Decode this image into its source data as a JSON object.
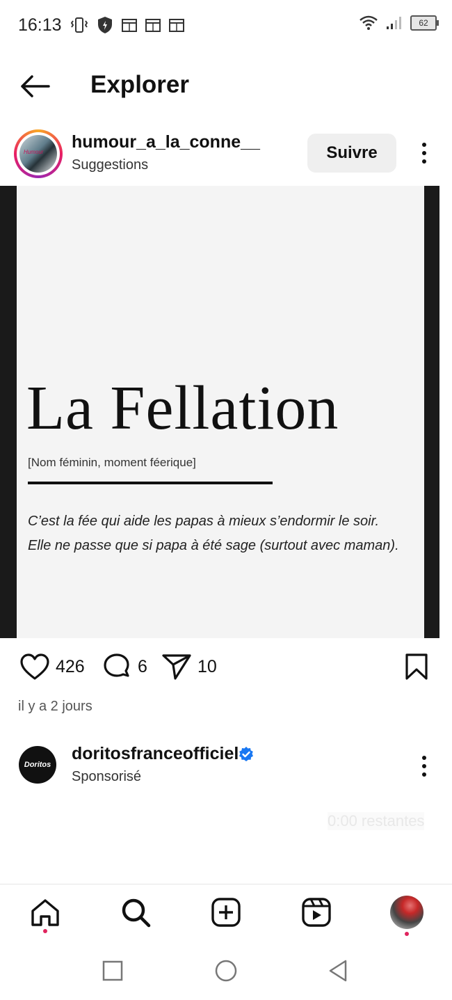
{
  "status_bar": {
    "time": "16:13",
    "battery": "62"
  },
  "header": {
    "title": "Explorer"
  },
  "post": {
    "username": "humour_a_la_conne__",
    "subtitle": "Suggestions",
    "follow_label": "Suivre",
    "image": {
      "word": "La Fellation",
      "grammar": "[Nom féminin, moment féerique]",
      "definition_line1": "C’est la fée qui aide les papas à mieux s’endormir le soir.",
      "definition_line2": "Elle ne passe que si papa à été sage (surtout avec maman)."
    },
    "likes": "426",
    "comments": "6",
    "shares": "10",
    "timestamp": "il y a 2 jours"
  },
  "sponsored": {
    "avatar_text": "Doritos",
    "username": "doritosfranceofficiel",
    "subtitle": "Sponsorisé",
    "remaining": "0:00 restantes"
  },
  "colors": {
    "accent_blue": "#1877f2",
    "notification_red": "#e0245e"
  }
}
